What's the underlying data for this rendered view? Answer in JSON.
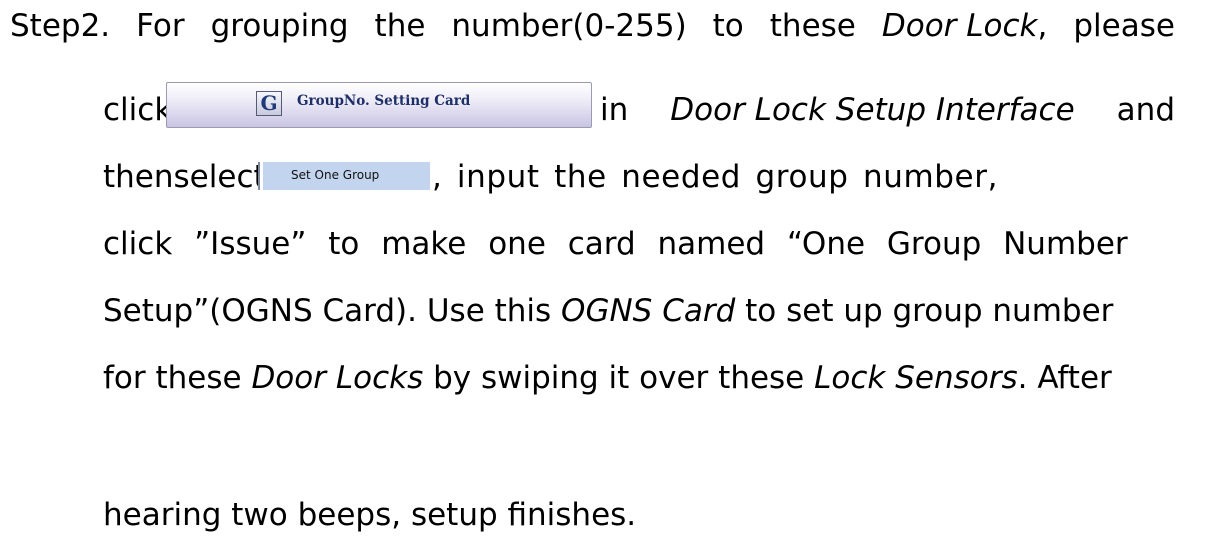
{
  "paragraph": {
    "line1": {
      "a": "Step2.",
      "b": "For",
      "c": "grouping",
      "d": "the",
      "e": "number(0-255)",
      "f": "to",
      "g": "these",
      "h": "Door Lock",
      "i": ",",
      "j": "please"
    },
    "line2": {
      "click": "click",
      "in": "in",
      "interface": "Door Lock Setup Interface",
      "and": "and"
    },
    "line3": {
      "then": "then",
      "select": "select",
      "rest": ", input the needed group number,"
    },
    "line4": "click ”Issue” to make one card named “One Group Number",
    "line5": {
      "a": "Setup”(OGNS Card). Use this ",
      "b": "OGNS Card",
      "c": " to set up group number"
    },
    "line6": {
      "a": "for these ",
      "b": "Door Locks",
      "c": " by swiping it over these ",
      "d": "Lock Sensors",
      "e": ". After"
    },
    "line7": "hearing two beeps, setup finishes."
  },
  "group_button": {
    "icon_letter": "G",
    "label": "GroupNo. Setting Card"
  },
  "set_one_group": {
    "label": "Set One Group"
  }
}
